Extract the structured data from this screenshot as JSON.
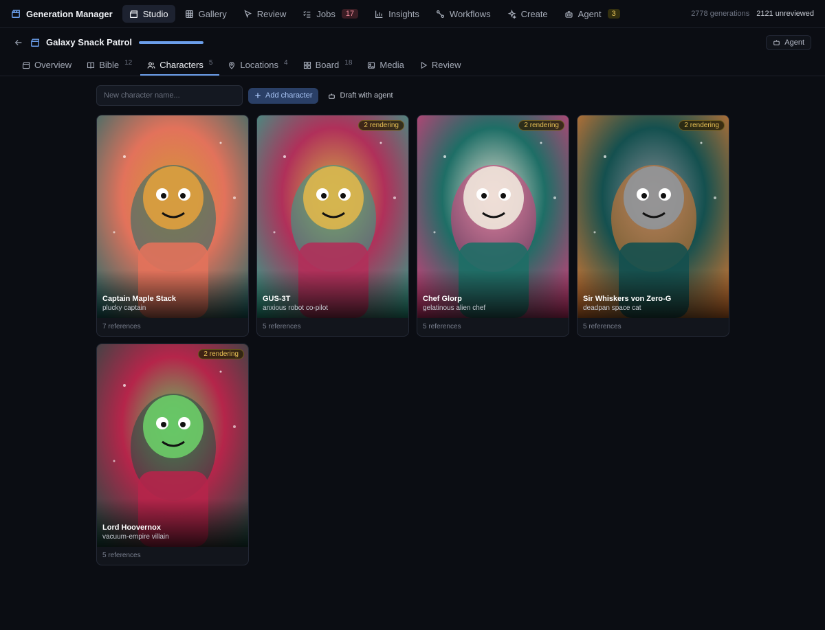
{
  "app": {
    "brand": "Generation Manager",
    "nav": [
      {
        "label": "Studio",
        "icon": "clapperboard-icon"
      },
      {
        "label": "Gallery",
        "icon": "grid-icon"
      },
      {
        "label": "Review",
        "icon": "cursor-icon"
      },
      {
        "label": "Jobs",
        "icon": "list-check-icon",
        "badge": "17"
      },
      {
        "label": "Insights",
        "icon": "bar-chart-icon"
      },
      {
        "label": "Workflows",
        "icon": "workflow-icon"
      },
      {
        "label": "Create",
        "icon": "sparkles-icon"
      },
      {
        "label": "Agent",
        "icon": "bot-icon",
        "badge": "3"
      }
    ],
    "stats": {
      "generations": "2778 generations",
      "unreviewed": "2121 unreviewed"
    }
  },
  "project": {
    "title": "Galaxy Snack Patrol",
    "progress": 1.0,
    "agent_button": "Agent"
  },
  "tabs": [
    {
      "label": "Overview",
      "count": "",
      "icon": "clapperboard-icon"
    },
    {
      "label": "Bible",
      "count": "12",
      "icon": "book-icon"
    },
    {
      "label": "Characters",
      "count": "5",
      "icon": "users-icon"
    },
    {
      "label": "Locations",
      "count": "4",
      "icon": "map-pin-icon"
    },
    {
      "label": "Board",
      "count": "18",
      "icon": "layout-grid-icon"
    },
    {
      "label": "Media",
      "count": "",
      "icon": "image-icon"
    },
    {
      "label": "Review",
      "count": "",
      "icon": "play-icon"
    }
  ],
  "toolbar": {
    "input_placeholder": "New character name...",
    "add_label": "Add character",
    "draft_label": "Draft with agent"
  },
  "characters": [
    {
      "name": "Captain Maple Stack",
      "role": "plucky captain",
      "refs": "7 references",
      "badge": "",
      "palette": [
        "#e2725b",
        "#1f6b6b",
        "#e8a23c"
      ]
    },
    {
      "name": "GUS-3T",
      "role": "anxious robot co-pilot",
      "refs": "5 references",
      "badge": "2 rendering",
      "palette": [
        "#b0305a",
        "#2aa58c",
        "#e6b84a"
      ]
    },
    {
      "name": "Chef Glorp",
      "role": "gelatinous alien chef",
      "refs": "5 references",
      "badge": "2 rendering",
      "palette": [
        "#1e6e66",
        "#e0387a",
        "#f2efe0"
      ]
    },
    {
      "name": "Sir Whiskers von Zero-G",
      "role": "deadpan space cat",
      "refs": "5 references",
      "badge": "2 rendering",
      "palette": [
        "#14504f",
        "#e67a2e",
        "#8f98a0"
      ]
    },
    {
      "name": "Lord Hoovernox",
      "role": "vacuum-empire villain",
      "refs": "5 references",
      "badge": "2 rendering",
      "palette": [
        "#b5254a",
        "#1d4d43",
        "#6fd46a"
      ]
    }
  ],
  "colors": {
    "accent": "#6b9eea",
    "background": "#0b0d13",
    "badge": "#e8c155"
  }
}
